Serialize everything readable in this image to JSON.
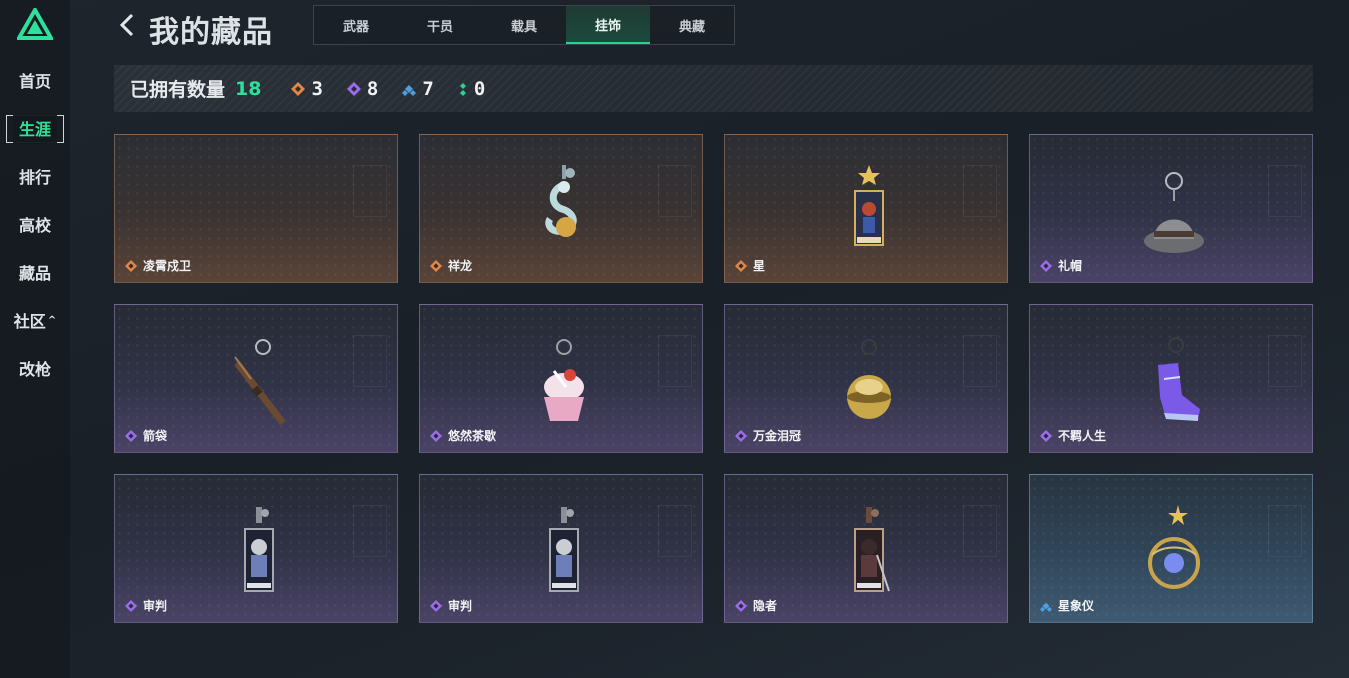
{
  "sidebar": {
    "items": [
      {
        "label": "首页"
      },
      {
        "label": "生涯",
        "active": true
      },
      {
        "label": "排行"
      },
      {
        "label": "高校"
      },
      {
        "label": "藏品"
      },
      {
        "label": "社区",
        "caret": "^"
      },
      {
        "label": "改枪"
      }
    ]
  },
  "header": {
    "title": "我的藏品",
    "tabs": [
      {
        "label": "武器"
      },
      {
        "label": "干员"
      },
      {
        "label": "载具"
      },
      {
        "label": "挂饰",
        "active": true
      },
      {
        "label": "典藏"
      }
    ]
  },
  "stats": {
    "owned_label": "已拥有数量",
    "owned_total": "18",
    "rarities": [
      {
        "rarity": "orange",
        "color": "#e2874a",
        "count": "3"
      },
      {
        "rarity": "purple",
        "color": "#9a6ee8",
        "count": "8"
      },
      {
        "rarity": "blue",
        "color": "#4f9ee0",
        "count": "7"
      },
      {
        "rarity": "green",
        "color": "#2fd191",
        "count": "0"
      }
    ]
  },
  "items": [
    {
      "name": "凌霄戍卫",
      "rarity": "orange",
      "icon": "empty"
    },
    {
      "name": "祥龙",
      "rarity": "orange",
      "icon": "dragon-charm-icon"
    },
    {
      "name": "星",
      "rarity": "orange",
      "icon": "tarot-star-card-icon"
    },
    {
      "name": "礼帽",
      "rarity": "purple",
      "icon": "fedora-hat-icon"
    },
    {
      "name": "箭袋",
      "rarity": "purple",
      "icon": "arrow-quiver-icon"
    },
    {
      "name": "悠然茶歇",
      "rarity": "purple",
      "icon": "cupcake-icon"
    },
    {
      "name": "万金泪冠",
      "rarity": "purple",
      "icon": "golden-crown-icon"
    },
    {
      "name": "不羁人生",
      "rarity": "purple",
      "icon": "sneaker-icon"
    },
    {
      "name": "审判",
      "rarity": "purple",
      "icon": "tarot-judgement-card-icon"
    },
    {
      "name": "审判",
      "rarity": "purple",
      "icon": "tarot-judgement-card-icon"
    },
    {
      "name": "隐者",
      "rarity": "purple",
      "icon": "tarot-hermit-card-icon"
    },
    {
      "name": "星象仪",
      "rarity": "blue",
      "icon": "astrolabe-icon"
    }
  ]
}
